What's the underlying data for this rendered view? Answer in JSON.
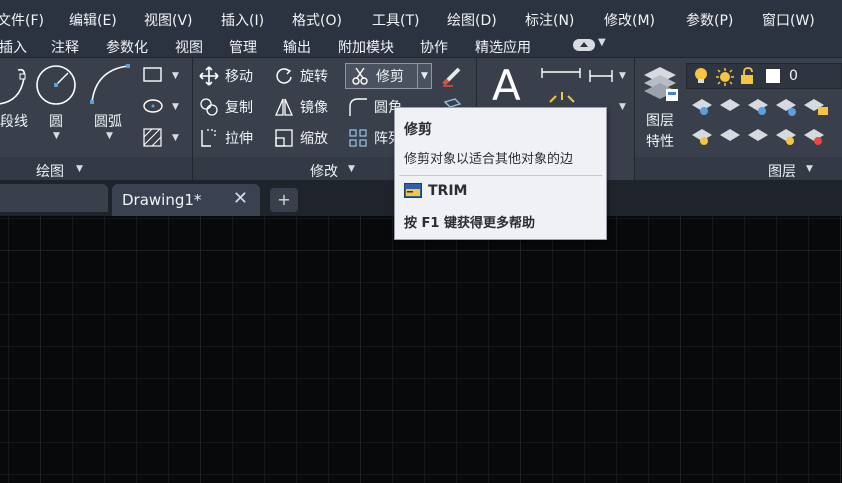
{
  "menu": [
    "文件(F)",
    "编辑(E)",
    "视图(V)",
    "插入(I)",
    "格式(O)",
    "工具(T)",
    "绘图(D)",
    "标注(N)",
    "修改(M)",
    "参数(P)",
    "窗口(W)"
  ],
  "ribbon_tabs": [
    "插入",
    "注释",
    "参数化",
    "视图",
    "管理",
    "输出",
    "附加模块",
    "协作",
    "精选应用"
  ],
  "draw_panel": {
    "line_label": "段线",
    "circle_label": "圆",
    "arc_label": "圆弧",
    "footer": "绘图"
  },
  "modify_panel": {
    "move": "移动",
    "rotate": "旋转",
    "trim": "修剪",
    "copy": "复制",
    "mirror": "镜像",
    "fillet": "圆角",
    "stretch": "拉伸",
    "scale": "缩放",
    "array": "阵列",
    "footer": "修改"
  },
  "layer_panel": {
    "layer_props_line1": "图层",
    "layer_props_line2": "特性",
    "current_layer": "0",
    "footer": "图层"
  },
  "tabs": {
    "active": "Drawing1*",
    "close": "✕",
    "new": "+"
  },
  "tooltip": {
    "title": "修剪",
    "description": "修剪对象以适合其他对象的边",
    "command": "TRIM",
    "help": "按 F1 键获得更多帮助"
  },
  "colors": {
    "accent_yellow": "#f5c542",
    "tooltip_bg": "#f0f1f4",
    "ribbon_bg": "#39404c"
  }
}
